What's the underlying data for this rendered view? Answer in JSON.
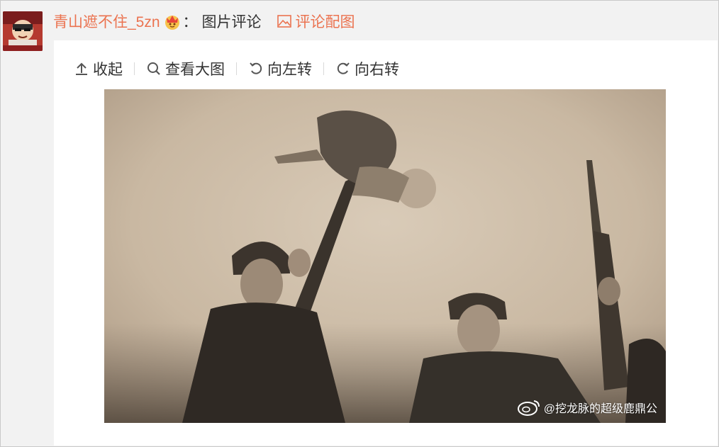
{
  "post": {
    "username": "青山遮不住_5zn",
    "colon": "：",
    "type_label": "图片评论",
    "comment_pic_label": "评论配图"
  },
  "toolbar": {
    "collapse_label": "收起",
    "view_large_label": "查看大图",
    "rotate_left_label": "向左转",
    "rotate_right_label": "向右转"
  },
  "image": {
    "watermark": "@挖龙脉的超级鹿鼎公"
  },
  "colors": {
    "accent": "#eb7350",
    "panel_bg": "#ffffff",
    "frame_bg": "#f2f2f2",
    "text": "#333333"
  },
  "icons": [
    "avatar",
    "vip-crown-icon",
    "image-icon",
    "upload-icon",
    "search-icon",
    "rotate-left-icon",
    "rotate-right-icon",
    "weibo-logo-icon"
  ]
}
